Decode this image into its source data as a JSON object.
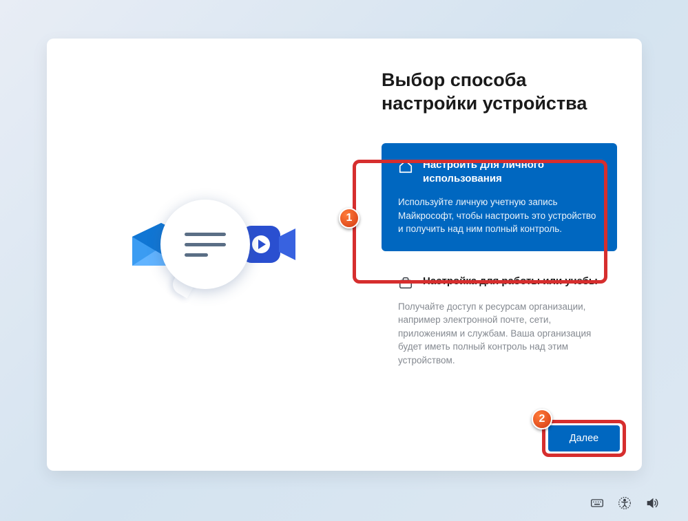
{
  "title": "Выбор способа настройки устройства",
  "options": [
    {
      "title": "Настроить для личного использования",
      "description": "Используйте личную учетную запись Майкрософт, чтобы настроить это устройство и получить над ним полный контроль."
    },
    {
      "title": "Настройка для работы или учебы",
      "description": "Получайте доступ к ресурсам организации, например электронной почте, сети, приложениям и службам. Ваша организация будет иметь полный контроль над этим устройством."
    }
  ],
  "next_button": "Далее",
  "annotations": {
    "badge1": "1",
    "badge2": "2"
  }
}
